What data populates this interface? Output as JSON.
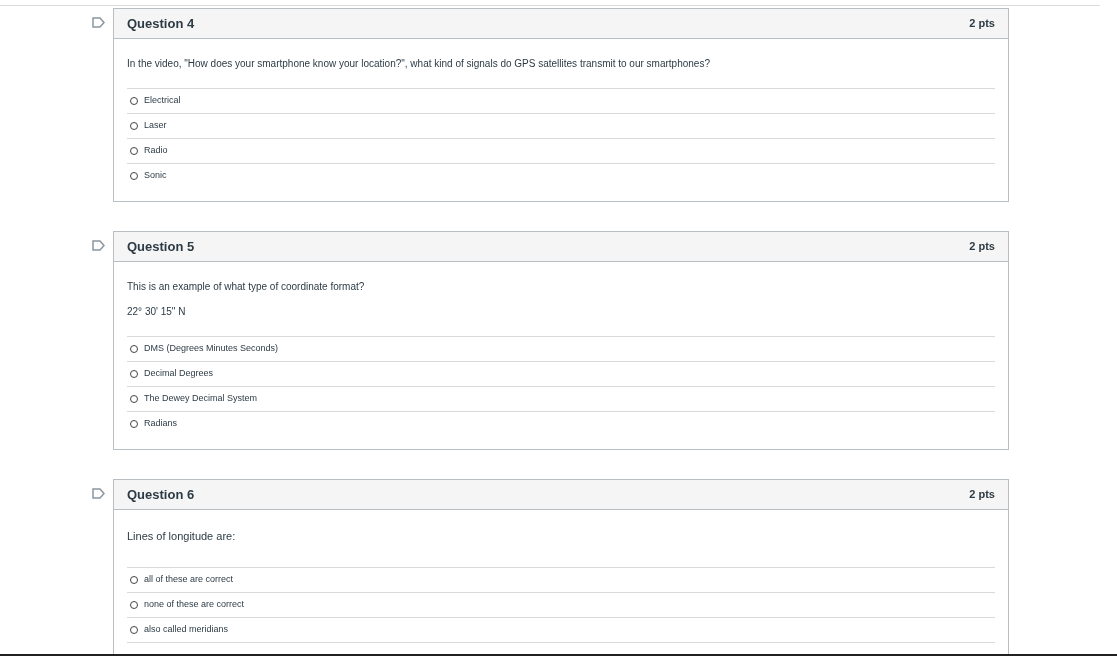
{
  "questions": [
    {
      "title": "Question 4",
      "points": "2 pts",
      "flagged": false,
      "paragraphs": [
        {
          "kind": "normal",
          "text": "In the video, \"How does your smartphone know your location?\", what kind of signals do GPS satellites transmit to our smartphones?"
        }
      ],
      "answers": [
        {
          "label": "Electrical",
          "selected": false
        },
        {
          "label": "Laser",
          "selected": false
        },
        {
          "label": "Radio",
          "selected": false
        },
        {
          "label": "Sonic",
          "selected": false
        }
      ],
      "continues": false
    },
    {
      "title": "Question 5",
      "points": "2 pts",
      "flagged": false,
      "paragraphs": [
        {
          "kind": "normal",
          "text": "This is an example of what type of coordinate format?"
        },
        {
          "kind": "normal",
          "text": "22° 30' 15\" N"
        }
      ],
      "answers": [
        {
          "label": "DMS (Degrees Minutes Seconds)",
          "selected": false
        },
        {
          "label": "Decimal Degrees",
          "selected": false
        },
        {
          "label": "The Dewey Decimal System",
          "selected": false
        },
        {
          "label": "Radians",
          "selected": false
        }
      ],
      "continues": false
    },
    {
      "title": "Question 6",
      "points": "2 pts",
      "flagged": false,
      "paragraphs": [
        {
          "kind": "large",
          "text": "Lines of longitude are:"
        }
      ],
      "answers": [
        {
          "label": "all of these are correct",
          "selected": false
        },
        {
          "label": "none of these are correct",
          "selected": false
        },
        {
          "label": "also called meridians",
          "selected": false
        }
      ],
      "continues": true
    }
  ]
}
